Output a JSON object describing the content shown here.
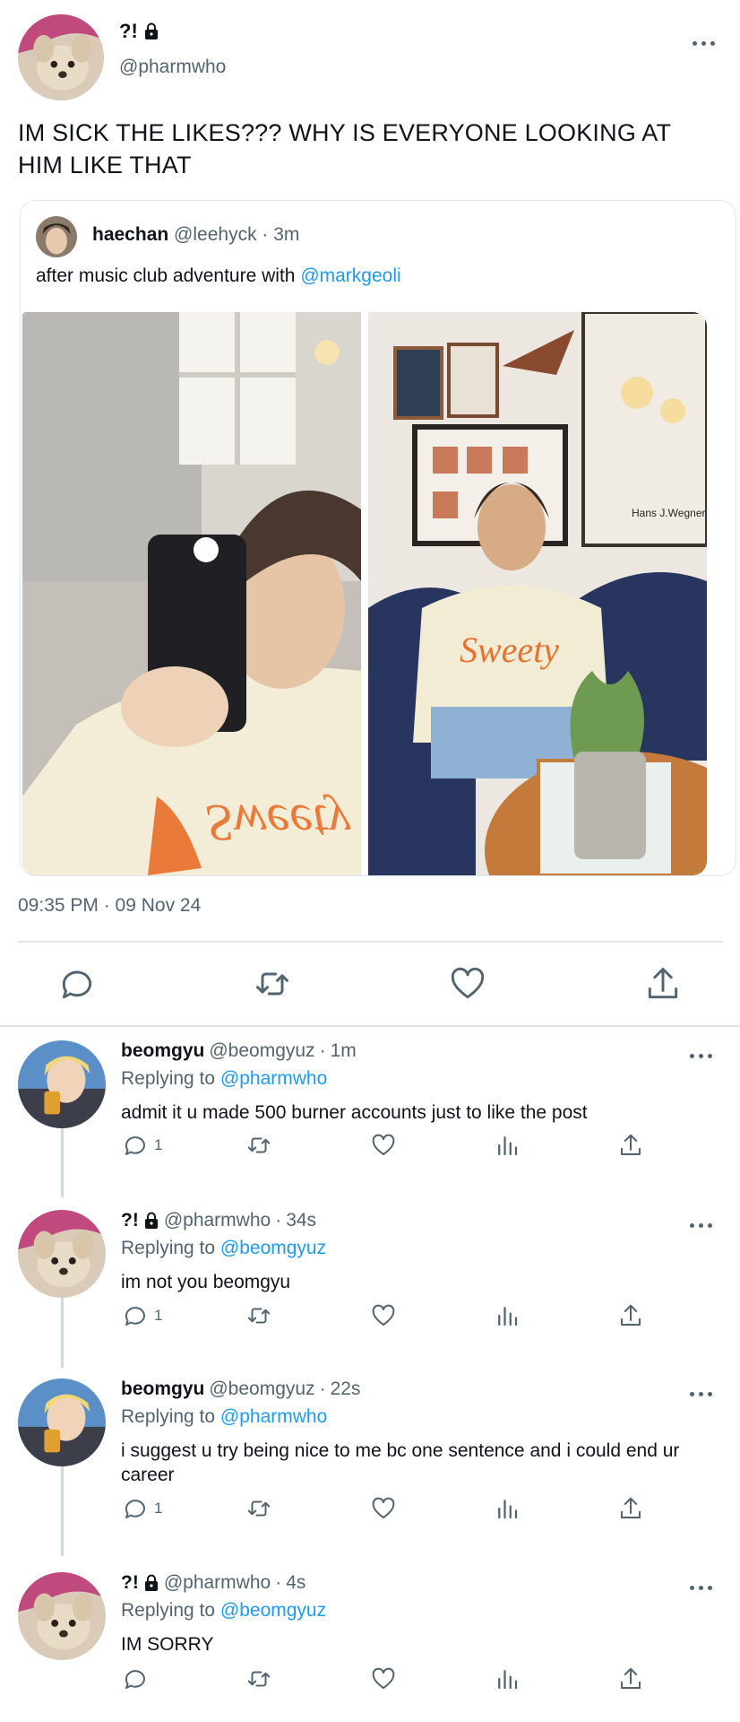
{
  "main": {
    "name": "?!",
    "handle": "@pharmwho",
    "text": "IM SICK THE LIKES??? WHY IS EVERYONE LOOKING AT HIM LIKE THAT",
    "timestamp": "09:35 PM · 09 Nov 24"
  },
  "quote": {
    "name": "haechan",
    "handle": "@leehyck",
    "time": "3m",
    "text_prefix": "after music club adventure with ",
    "mention": "@markgeoli",
    "photo_right_caption": "Hans J.Wegner",
    "shirt_text": "Sweety"
  },
  "replies": [
    {
      "name": "beomgyu",
      "handle": "@beomgyuz",
      "time": "1m",
      "replying_label": "Replying to ",
      "replying_to": "@pharmwho",
      "text": "admit it u made 500 burner accounts just to like the post",
      "reply_count": "1",
      "avatar": "beomgyu"
    },
    {
      "name": "?!",
      "handle": "@pharmwho",
      "time": "34s",
      "replying_label": "Replying to ",
      "replying_to": "@beomgyuz",
      "text": "im not you beomgyu",
      "reply_count": "1",
      "avatar": "dog"
    },
    {
      "name": "beomgyu",
      "handle": "@beomgyuz",
      "time": "22s",
      "replying_label": "Replying to ",
      "replying_to": "@pharmwho",
      "text": "i suggest u try being nice to me bc one sentence and i could end ur career",
      "reply_count": "1",
      "avatar": "beomgyu"
    },
    {
      "name": "?!",
      "handle": "@pharmwho",
      "time": "4s",
      "replying_label": "Replying to ",
      "replying_to": "@beomgyuz",
      "text": "IM SORRY",
      "reply_count": "",
      "avatar": "dog"
    }
  ],
  "colors": {
    "link": "#1d9bf0",
    "muted": "#536471",
    "divider": "#e1e8ed"
  },
  "icons": [
    "lock-icon",
    "more-icon",
    "reply-icon",
    "retweet-icon",
    "like-icon",
    "views-icon",
    "share-icon"
  ]
}
